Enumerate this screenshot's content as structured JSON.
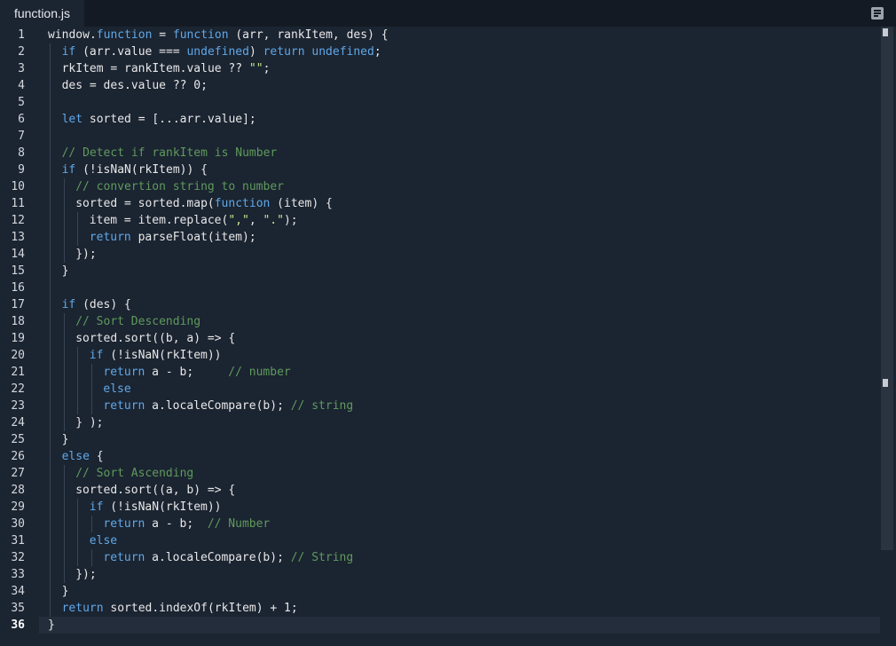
{
  "tab": {
    "label": "function.js"
  },
  "colors": {
    "background": "#1b2431",
    "keyword": "#5fa8e8",
    "comment": "#5f9a5c",
    "string": "#c3e88d",
    "text": "#e8e8e8"
  },
  "icons": {
    "menu": "list-menu-icon"
  },
  "editor": {
    "active_line": 36,
    "lines": [
      {
        "n": "1",
        "indent": 0,
        "tokens": [
          [
            "t",
            "window."
          ],
          [
            "k",
            "function"
          ],
          [
            "t",
            " = "
          ],
          [
            "k",
            "function"
          ],
          [
            "t",
            " (arr, rankItem, des) {"
          ]
        ]
      },
      {
        "n": "2",
        "indent": 1,
        "tokens": [
          [
            "k",
            "if"
          ],
          [
            "t",
            " (arr.value === "
          ],
          [
            "k",
            "undefined"
          ],
          [
            "t",
            ") "
          ],
          [
            "k",
            "return"
          ],
          [
            "t",
            " "
          ],
          [
            "k",
            "undefined"
          ],
          [
            "t",
            ";"
          ]
        ]
      },
      {
        "n": "3",
        "indent": 1,
        "tokens": [
          [
            "t",
            "rkItem = rankItem.value ?? "
          ],
          [
            "s",
            "\"\""
          ],
          [
            "t",
            ";"
          ]
        ]
      },
      {
        "n": "4",
        "indent": 1,
        "tokens": [
          [
            "t",
            "des = des.value ?? 0;"
          ]
        ]
      },
      {
        "n": "5",
        "indent": 1,
        "tokens": []
      },
      {
        "n": "6",
        "indent": 1,
        "tokens": [
          [
            "k",
            "let"
          ],
          [
            "t",
            " sorted = [...arr.value];"
          ]
        ]
      },
      {
        "n": "7",
        "indent": 1,
        "tokens": []
      },
      {
        "n": "8",
        "indent": 1,
        "tokens": [
          [
            "c",
            "// Detect if rankItem is Number"
          ]
        ]
      },
      {
        "n": "9",
        "indent": 1,
        "tokens": [
          [
            "k",
            "if"
          ],
          [
            "t",
            " (!isNaN(rkItem)) {"
          ]
        ]
      },
      {
        "n": "10",
        "indent": 2,
        "tokens": [
          [
            "c",
            "// convertion string to number"
          ]
        ]
      },
      {
        "n": "11",
        "indent": 2,
        "tokens": [
          [
            "t",
            "sorted = sorted.map("
          ],
          [
            "k",
            "function"
          ],
          [
            "t",
            " (item) {"
          ]
        ]
      },
      {
        "n": "12",
        "indent": 3,
        "tokens": [
          [
            "t",
            "item = item.replace("
          ],
          [
            "s",
            "\",\""
          ],
          [
            "t",
            ", "
          ],
          [
            "s",
            "\".\""
          ],
          [
            "t",
            ");"
          ]
        ]
      },
      {
        "n": "13",
        "indent": 3,
        "tokens": [
          [
            "k",
            "return"
          ],
          [
            "t",
            " parseFloat(item);"
          ]
        ]
      },
      {
        "n": "14",
        "indent": 2,
        "tokens": [
          [
            "t",
            "});"
          ]
        ]
      },
      {
        "n": "15",
        "indent": 1,
        "tokens": [
          [
            "t",
            "}"
          ]
        ]
      },
      {
        "n": "16",
        "indent": 1,
        "tokens": []
      },
      {
        "n": "17",
        "indent": 1,
        "tokens": [
          [
            "k",
            "if"
          ],
          [
            "t",
            " (des) {"
          ]
        ]
      },
      {
        "n": "18",
        "indent": 2,
        "tokens": [
          [
            "c",
            "// Sort Descending"
          ]
        ]
      },
      {
        "n": "19",
        "indent": 2,
        "tokens": [
          [
            "t",
            "sorted.sort((b, a) => {"
          ]
        ]
      },
      {
        "n": "20",
        "indent": 3,
        "tokens": [
          [
            "k",
            "if"
          ],
          [
            "t",
            " (!isNaN(rkItem))"
          ]
        ]
      },
      {
        "n": "21",
        "indent": 4,
        "tokens": [
          [
            "k",
            "return"
          ],
          [
            "t",
            " a - b;     "
          ],
          [
            "c",
            "// number"
          ]
        ]
      },
      {
        "n": "22",
        "indent": 4,
        "tokens": [
          [
            "k",
            "else"
          ]
        ]
      },
      {
        "n": "23",
        "indent": 4,
        "tokens": [
          [
            "k",
            "return"
          ],
          [
            "t",
            " a.localeCompare(b); "
          ],
          [
            "c",
            "// string"
          ]
        ]
      },
      {
        "n": "24",
        "indent": 2,
        "tokens": [
          [
            "t",
            "} );"
          ]
        ]
      },
      {
        "n": "25",
        "indent": 1,
        "tokens": [
          [
            "t",
            "}"
          ]
        ]
      },
      {
        "n": "26",
        "indent": 1,
        "tokens": [
          [
            "k",
            "else"
          ],
          [
            "t",
            " {"
          ]
        ]
      },
      {
        "n": "27",
        "indent": 2,
        "tokens": [
          [
            "c",
            "// Sort Ascending"
          ]
        ]
      },
      {
        "n": "28",
        "indent": 2,
        "tokens": [
          [
            "t",
            "sorted.sort((a, b) => {"
          ]
        ]
      },
      {
        "n": "29",
        "indent": 3,
        "tokens": [
          [
            "k",
            "if"
          ],
          [
            "t",
            " (!isNaN(rkItem))"
          ]
        ]
      },
      {
        "n": "30",
        "indent": 4,
        "tokens": [
          [
            "k",
            "return"
          ],
          [
            "t",
            " a - b;  "
          ],
          [
            "c",
            "// Number"
          ]
        ]
      },
      {
        "n": "31",
        "indent": 3,
        "tokens": [
          [
            "k",
            "else"
          ]
        ]
      },
      {
        "n": "32",
        "indent": 4,
        "tokens": [
          [
            "k",
            "return"
          ],
          [
            "t",
            " a.localeCompare(b); "
          ],
          [
            "c",
            "// String"
          ]
        ]
      },
      {
        "n": "33",
        "indent": 2,
        "tokens": [
          [
            "t",
            "});"
          ]
        ]
      },
      {
        "n": "34",
        "indent": 1,
        "tokens": [
          [
            "t",
            "}"
          ]
        ]
      },
      {
        "n": "35",
        "indent": 1,
        "tokens": [
          [
            "k",
            "return"
          ],
          [
            "t",
            " sorted.indexOf(rkItem) + 1;"
          ]
        ]
      },
      {
        "n": "36",
        "indent": 0,
        "tokens": [
          [
            "t",
            "}"
          ]
        ]
      }
    ]
  }
}
